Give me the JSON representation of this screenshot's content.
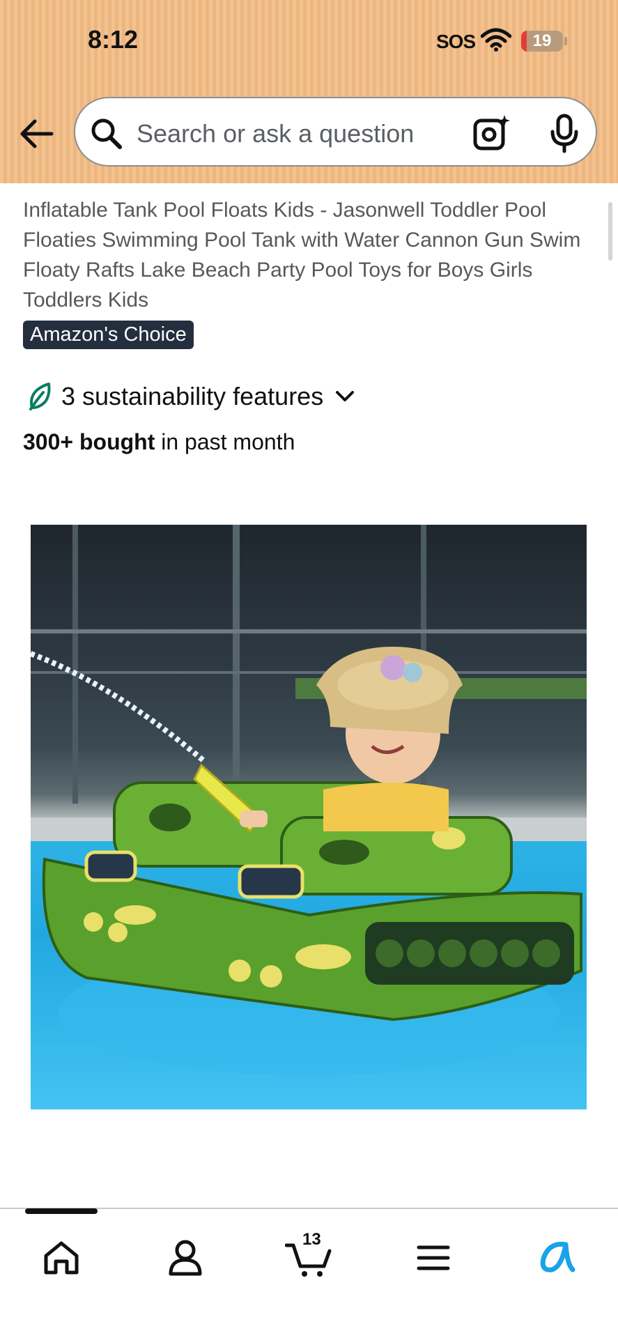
{
  "status_bar": {
    "time": "8:12",
    "sos": "SOS",
    "battery_level": "19"
  },
  "search": {
    "placeholder": "Search or ask a question"
  },
  "product": {
    "title": "Inflatable Tank Pool Floats Kids - Jasonwell Toddler Pool Floaties Swimming Pool Tank with Water Cannon Gun Swim Floaty Rafts Lake Beach Party Pool Toys for Boys Girls Toddlers Kids",
    "badge": "Amazon's Choice",
    "sustainability": "3 sustainability features",
    "bought_bold": "300+ bought",
    "bought_rest": " in past month"
  },
  "nav": {
    "cart_count": "13"
  },
  "colors": {
    "header_bg": "#f3c28f",
    "badge_bg": "#232f3e",
    "leaf": "#067d62",
    "alexa": "#1aa3e8"
  }
}
